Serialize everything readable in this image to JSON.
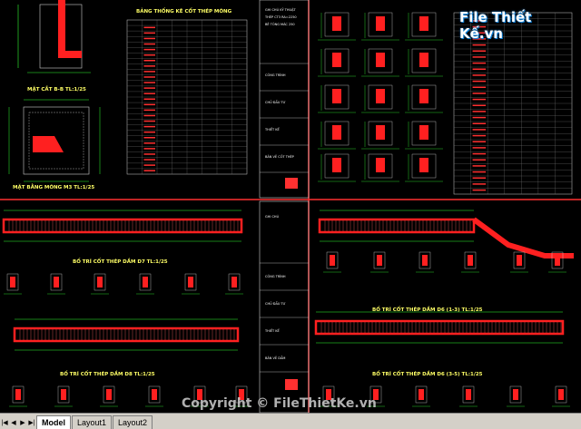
{
  "drawing": {
    "section_b": "MẶT CẮT B-B TL:1/25",
    "foundation_plan": "MẶT BẰNG MÓNG M3 TL:1/25",
    "table_title": "BẢNG THỐNG KÊ CỐT THÉP MÓNG",
    "beam_d7": "BỐ TRÍ CỐT THÉP DẦM D7 TL:1/25",
    "beam_d8": "BỐ TRÍ CỐT THÉP DẦM D8 TL:1/25",
    "beam_d6_13": "BỐ TRÍ CỐT THÉP DẦM D6 (1-3) TL:1/25",
    "beam_d6_35": "BỐ TRÍ CỐT THÉP DẦM D6 (3-5) TL:1/25"
  },
  "watermark": {
    "logo": "File Thiết Kế.vn",
    "copyright": "Copyright © FileThietKe.vn"
  },
  "layout_tabs": [
    "Model",
    "Layout1",
    "Layout2"
  ],
  "colors": {
    "background": "#000000",
    "rebar": "#ff2020",
    "dim": "#33ff33",
    "text": "#ffff66"
  }
}
